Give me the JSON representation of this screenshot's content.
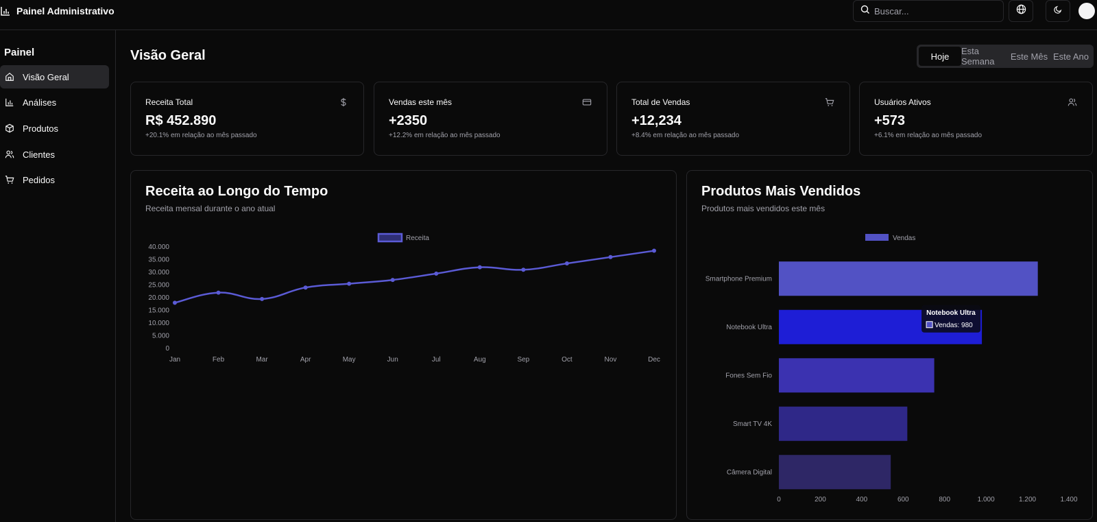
{
  "header": {
    "title": "Painel Administrativo",
    "search_placeholder": "Buscar..."
  },
  "sidebar": {
    "heading": "Painel",
    "items": [
      {
        "label": "Visão Geral",
        "icon": "home-icon",
        "active": true
      },
      {
        "label": "Análises",
        "icon": "bar-chart-icon",
        "active": false
      },
      {
        "label": "Produtos",
        "icon": "package-icon",
        "active": false
      },
      {
        "label": "Clientes",
        "icon": "users-icon",
        "active": false
      },
      {
        "label": "Pedidos",
        "icon": "cart-icon",
        "active": false
      }
    ]
  },
  "main": {
    "title": "Visão Geral",
    "tabs": [
      {
        "label": "Hoje",
        "active": true
      },
      {
        "label": "Esta Semana",
        "active": false
      },
      {
        "label": "Este Mês",
        "active": false
      },
      {
        "label": "Este Ano",
        "active": false
      }
    ],
    "stats": [
      {
        "title": "Receita Total",
        "value": "R$ 452.890",
        "sub": "+20.1% em relação ao mês passado",
        "icon": "dollar-icon"
      },
      {
        "title": "Vendas este mês",
        "value": "+2350",
        "sub": "+12.2% em relação ao mês passado",
        "icon": "credit-card-icon"
      },
      {
        "title": "Total de Vendas",
        "value": "+12,234",
        "sub": "+8.4% em relação ao mês passado",
        "icon": "cart-icon"
      },
      {
        "title": "Usuários Ativos",
        "value": "+573",
        "sub": "+6.1% em relação ao mês passado",
        "icon": "users-icon"
      }
    ],
    "revenue_panel": {
      "title": "Receita ao Longo do Tempo",
      "subtitle": "Receita mensal durante o ano atual"
    },
    "products_panel": {
      "title": "Produtos Mais Vendidos",
      "subtitle": "Produtos mais vendidos este mês"
    }
  },
  "colors": {
    "accent": "#5b5bd6",
    "bar_colors": [
      "#5252c4",
      "#1e1ed6",
      "#3b32b0",
      "#2f2888",
      "#2e2766"
    ]
  },
  "chart_data": [
    {
      "type": "line",
      "categories": [
        "Jan",
        "Feb",
        "Mar",
        "Apr",
        "May",
        "Jun",
        "Jul",
        "Aug",
        "Sep",
        "Oct",
        "Nov",
        "Dec"
      ],
      "series": [
        {
          "name": "Receita",
          "values": [
            18000,
            22000,
            19500,
            24000,
            25500,
            27000,
            29500,
            32000,
            31000,
            33500,
            36000,
            38500
          ]
        }
      ],
      "ylim": [
        0,
        40000
      ],
      "yticks": [
        "0",
        "5.000",
        "10.000",
        "15.000",
        "20.000",
        "25.000",
        "30.000",
        "35.000",
        "40.000"
      ],
      "legend": "top-center"
    },
    {
      "type": "bar",
      "orientation": "horizontal",
      "categories": [
        "Smartphone Premium",
        "Notebook Ultra",
        "Fones Sem Fio",
        "Smart TV 4K",
        "Câmera Digital"
      ],
      "series": [
        {
          "name": "Vendas",
          "values": [
            1250,
            980,
            750,
            620,
            540
          ]
        }
      ],
      "xlim": [
        0,
        1400
      ],
      "xticks": [
        "0",
        "200",
        "400",
        "600",
        "800",
        "1.000",
        "1.200",
        "1.400"
      ],
      "legend": "top-center",
      "tooltip": {
        "title": "Notebook Ultra",
        "label": "Vendas: 980"
      }
    }
  ]
}
